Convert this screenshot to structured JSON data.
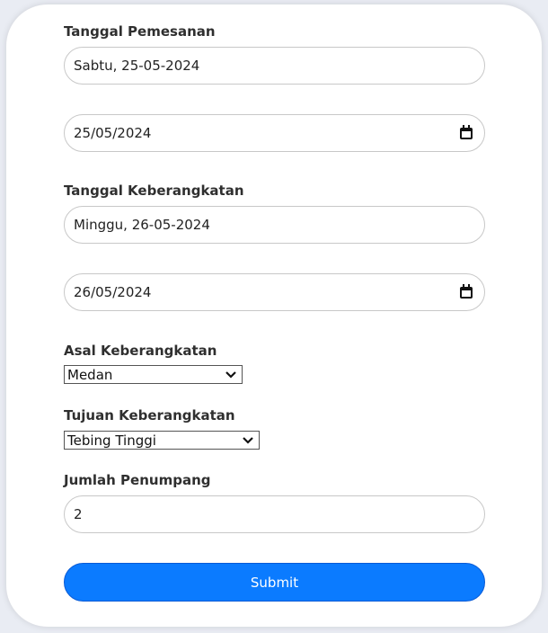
{
  "form": {
    "order_date": {
      "label": "Tanggal Pemesanan",
      "text_value": "Sabtu, 25-05-2024",
      "date_value": "25/05/2024"
    },
    "departure_date": {
      "label": "Tanggal Keberangkatan",
      "text_value": "Minggu, 26-05-2024",
      "date_value": "26/05/2024"
    },
    "origin": {
      "label": "Asal Keberangkatan",
      "selected": "Medan"
    },
    "destination": {
      "label": "Tujuan Keberangkatan",
      "selected": "Tebing Tinggi"
    },
    "passengers": {
      "label": "Jumlah Penumpang",
      "value": "2"
    },
    "submit_label": "Submit"
  },
  "icons": {
    "date_picker": "calendar-icon",
    "dropdown": "chevron-down-icon"
  },
  "colors": {
    "accent": "#0b7bff",
    "card_background": "#ffffff",
    "page_background": "#e9ecf3"
  }
}
